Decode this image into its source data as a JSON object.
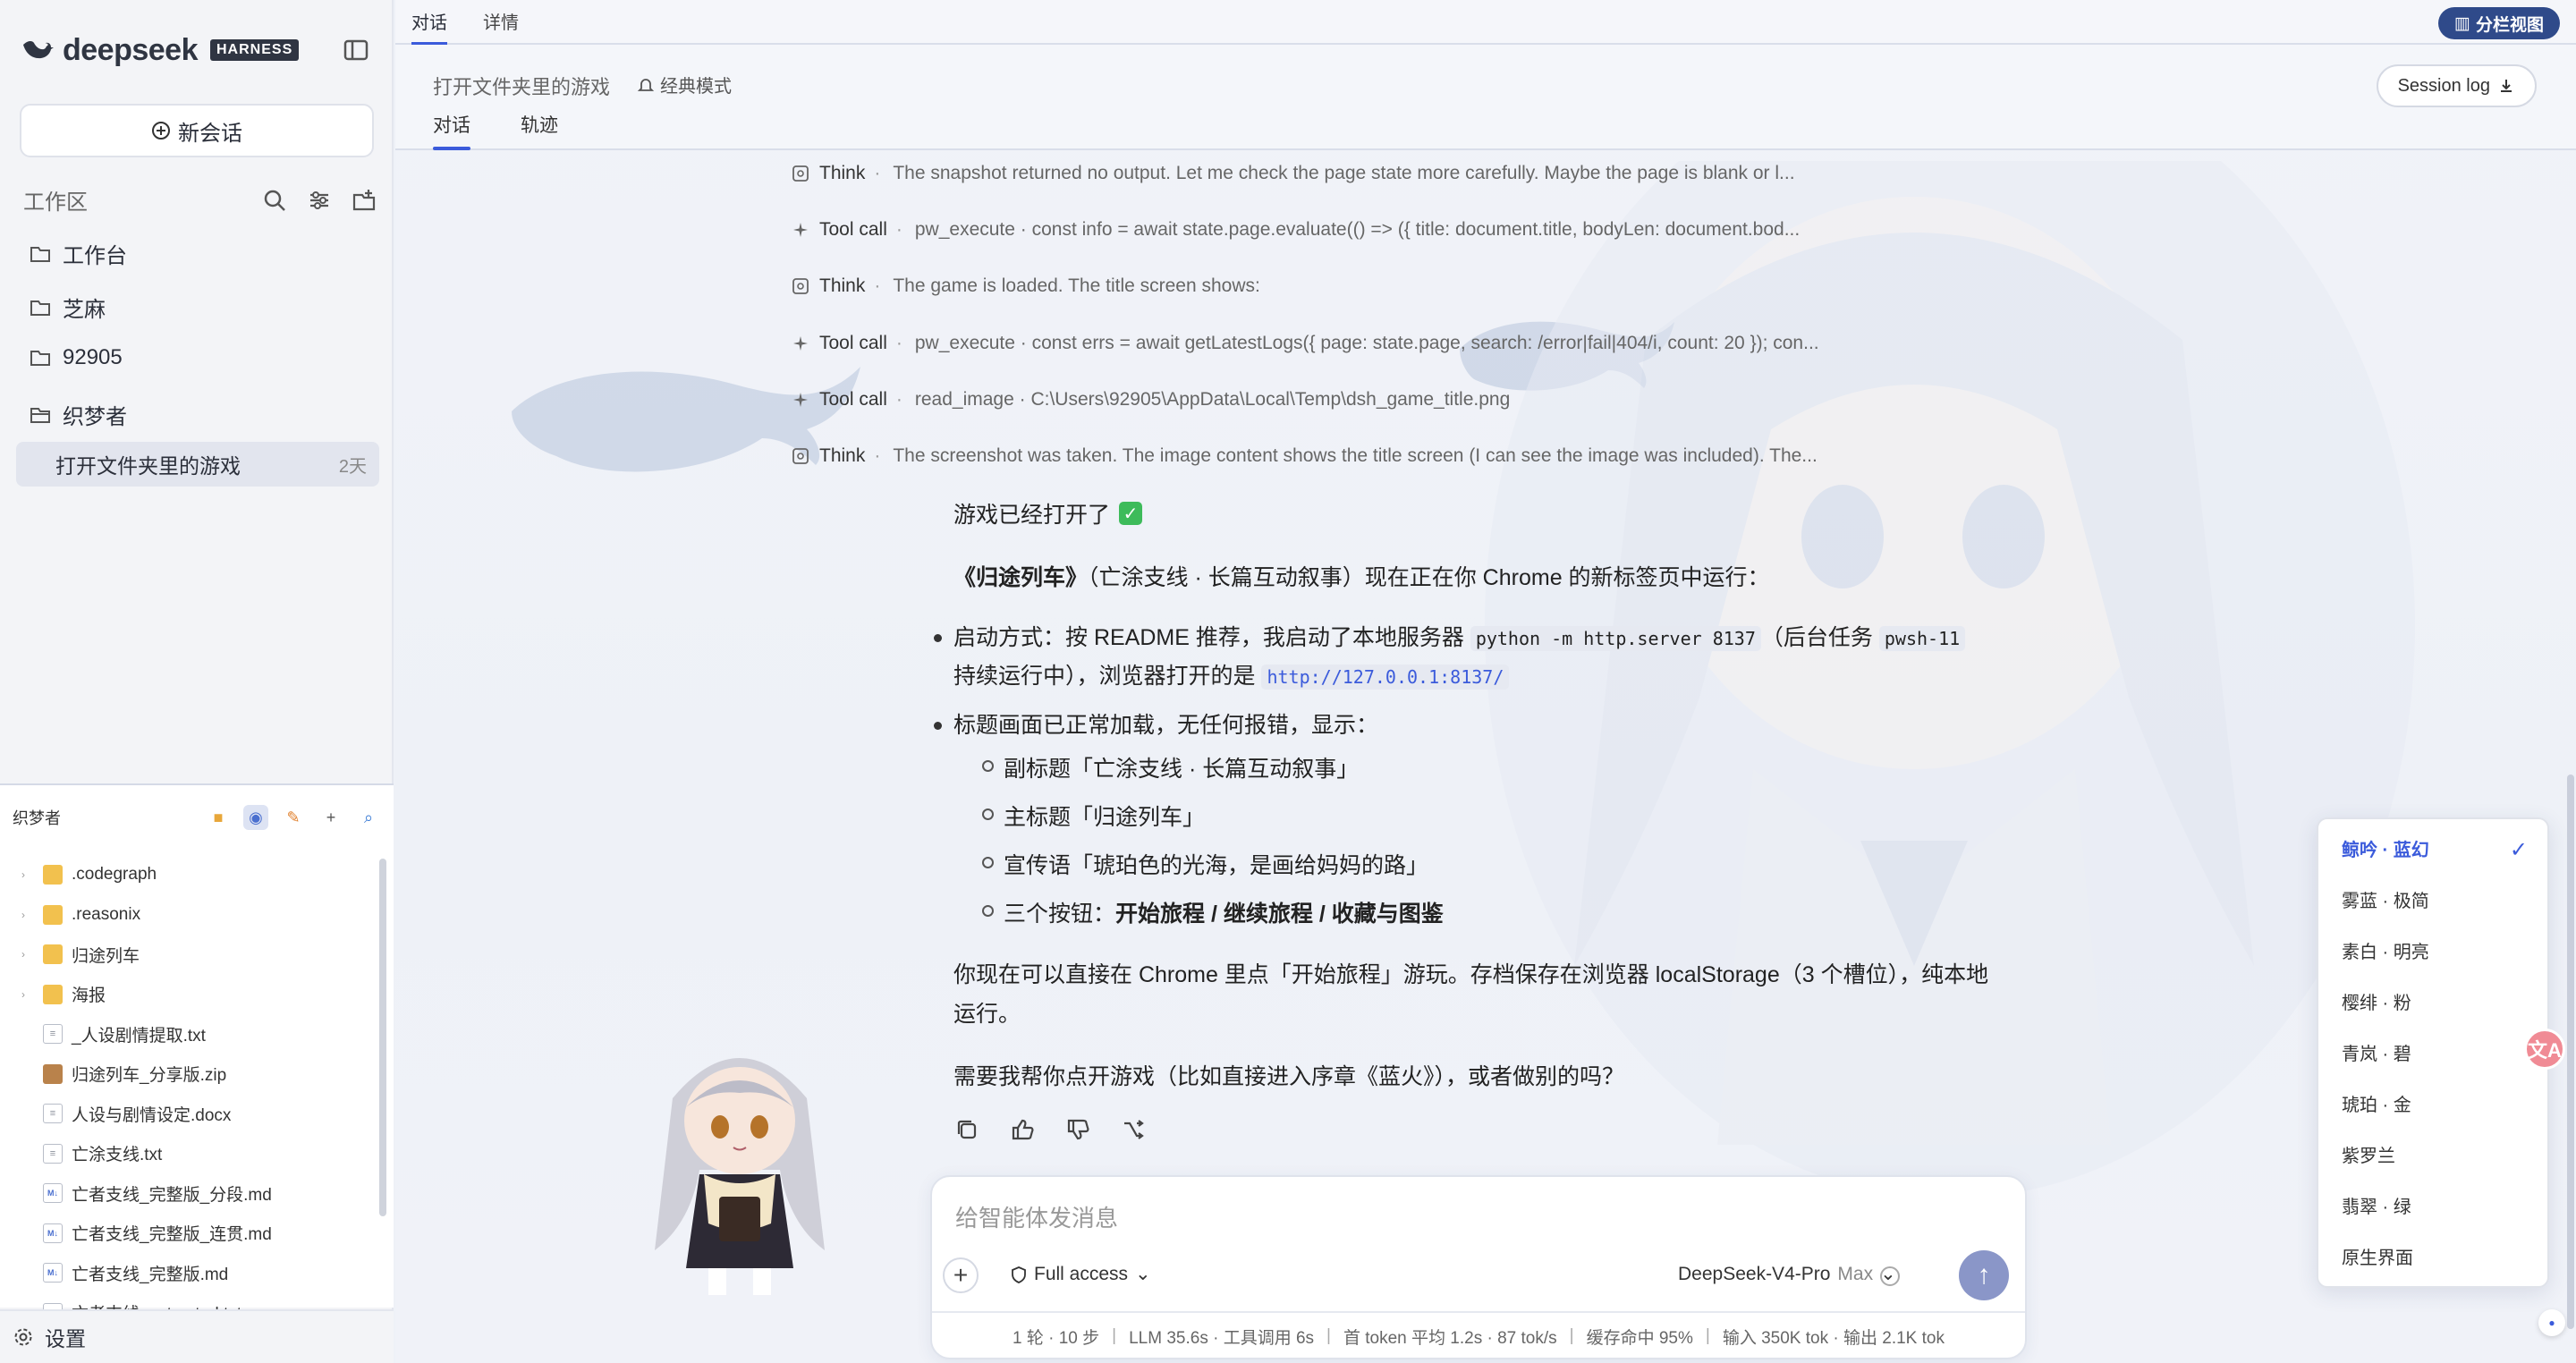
{
  "sidebar": {
    "brand_name": "deepseek",
    "brand_badge": "HARNESS",
    "new_chat": "新会话",
    "workspace_title": "工作区",
    "folders": [
      "工作台",
      "芝麻",
      "92905",
      "织梦者"
    ],
    "active_session": {
      "title": "打开文件夹里的游戏",
      "age": "2天"
    },
    "settings": "设置"
  },
  "filetree": {
    "title": "织梦者",
    "items": [
      {
        "name": ".codegraph",
        "type": "folder"
      },
      {
        "name": ".reasonix",
        "type": "folder"
      },
      {
        "name": "归途列车",
        "type": "folder"
      },
      {
        "name": "海报",
        "type": "folder"
      },
      {
        "name": "_人设剧情提取.txt",
        "type": "txt"
      },
      {
        "name": "归途列车_分享版.zip",
        "type": "zip"
      },
      {
        "name": "人设与剧情设定.docx",
        "type": "txt"
      },
      {
        "name": "亡涂支线.txt",
        "type": "txt"
      },
      {
        "name": "亡者支线_完整版_分段.md",
        "type": "md"
      },
      {
        "name": "亡者支线_完整版_连贯.md",
        "type": "md"
      },
      {
        "name": "亡者支线_完整版.md",
        "type": "md"
      },
      {
        "name": "亡者支线_extracted.txt",
        "type": "txt"
      }
    ]
  },
  "topbar": {
    "tabs": [
      "对话",
      "详情"
    ],
    "split_view": "分栏视图"
  },
  "header": {
    "title": "打开文件夹里的游戏",
    "mode": "经典模式",
    "tabs": [
      "对话",
      "轨迹"
    ],
    "session_log": "Session log"
  },
  "steps": [
    {
      "kind": "Think",
      "text": "The snapshot returned no output. Let me check the page state more carefully. Maybe the page is blank or l..."
    },
    {
      "kind": "Tool call",
      "text": "pw_execute · const info = await state.page.evaluate(() => ({ title: document.title, bodyLen: document.bod..."
    },
    {
      "kind": "Think",
      "text": "The game is loaded. The title screen shows:"
    },
    {
      "kind": "Tool call",
      "text": "pw_execute · const errs = await getLatestLogs({ page: state.page, search: /error|fail|404/i, count: 20 }); con..."
    },
    {
      "kind": "Tool call",
      "text": "read_image · C:\\Users\\92905\\AppData\\Local\\Temp\\dsh_game_title.png"
    },
    {
      "kind": "Think",
      "text": "The screenshot was taken. The image content shows the title screen (I can see the image was included). The..."
    }
  ],
  "message": {
    "heading": "游戏已经打开了",
    "intro_bold": "《归途列车》",
    "intro_rest": "（亡涂支线 · 长篇互动叙事）现在正在你 Chrome 的新标签页中运行：",
    "b1_a": "启动方式：按 README 推荐，我启动了本地服务器",
    "b1_code1": "python -m http.server 8137",
    "b1_b": "（后台任务",
    "b1_code2": "pwsh-11",
    "b1_c": "持续运行中），浏览器打开的是",
    "b1_link": "http://127.0.0.1:8137/",
    "b2": "标题画面已正常加载，无任何报错，显示：",
    "sub1": "副标题「亡涂支线 · 长篇互动叙事」",
    "sub2": "主标题「归途列车」",
    "sub3": "宣传语「琥珀色的光海，是画给妈妈的路」",
    "sub4_a": "三个按钮：",
    "sub4_b": "开始旅程",
    "sub4_c": "继续旅程",
    "sub4_d": "收藏与图鉴",
    "sub4_sep": " / ",
    "p1_line1": "你现在可以直接在 Chrome 里点「开始旅程」游玩。存档保存在浏览器 localStorage（3 个槽位），纯本地",
    "p1_line2": "运行。",
    "p2": "需要我帮你点开游戏（比如直接进入序章《蓝火》），或者做别的吗？"
  },
  "composer": {
    "placeholder": "给智能体发消息",
    "access": "Full access",
    "model": "DeepSeek-V4-Pro",
    "model_tier": "Max",
    "stats": [
      "1 轮 · 10 步",
      "LLM 35.6s · 工具调用 6s",
      "首 token 平均 1.2s · 87 tok/s",
      "缓存命中 95%",
      "输入 350K tok · 输出 2.1K tok"
    ]
  },
  "theme_menu": {
    "items": [
      "鲸吟 · 蓝幻",
      "雾蓝 · 极简",
      "素白 · 明亮",
      "樱绯 · 粉",
      "青岚 · 碧",
      "琥珀 · 金",
      "紫罗兰",
      "翡翠 · 绿",
      "原生界面"
    ],
    "selected_index": 0,
    "check": "✓"
  },
  "translate_glyph": "文A",
  "colors": {
    "accent": "#3b5bdb",
    "success": "#3dbb5a",
    "split_btn": "#2f4a8a"
  }
}
